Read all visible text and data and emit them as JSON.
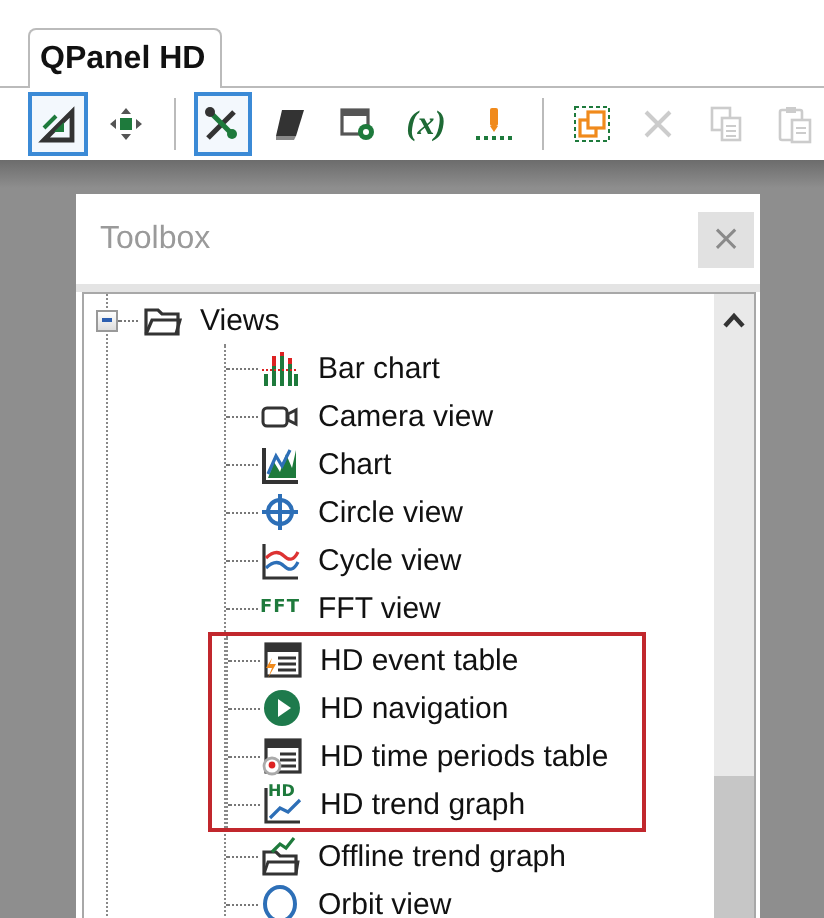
{
  "tabs": [
    {
      "label": "QPanel HD",
      "selected": true
    }
  ],
  "toolbar": [
    {
      "kind": "button",
      "pressed": true,
      "disabled": false
    },
    {
      "kind": "button",
      "pressed": false,
      "disabled": false
    },
    {
      "kind": "separator"
    },
    {
      "kind": "button",
      "pressed": true,
      "disabled": false
    },
    {
      "kind": "button",
      "pressed": false,
      "disabled": false
    },
    {
      "kind": "button",
      "pressed": false,
      "disabled": false
    },
    {
      "kind": "text",
      "label": "(x)",
      "pressed": false,
      "disabled": false
    },
    {
      "kind": "button",
      "pressed": false,
      "disabled": false
    },
    {
      "kind": "separator"
    },
    {
      "kind": "button",
      "pressed": false,
      "disabled": false
    },
    {
      "kind": "button",
      "pressed": false,
      "disabled": true
    },
    {
      "kind": "button",
      "pressed": false,
      "disabled": true
    },
    {
      "kind": "button",
      "pressed": false,
      "disabled": true
    }
  ],
  "toolbox": {
    "title": "Toolbox",
    "close": "×",
    "tree": [
      {
        "label": "Views",
        "expanded": true,
        "children": [
          {
            "label": "Bar chart",
            "highlighted": false
          },
          {
            "label": "Camera view",
            "highlighted": false
          },
          {
            "label": "Chart",
            "highlighted": false
          },
          {
            "label": "Circle view",
            "highlighted": false
          },
          {
            "label": "Cycle view",
            "highlighted": false
          },
          {
            "label": "FFT view",
            "icon_text": "FFT",
            "highlighted": false
          },
          {
            "label": "HD event table",
            "highlighted": true
          },
          {
            "label": "HD navigation",
            "highlighted": true
          },
          {
            "label": "HD time periods table",
            "highlighted": true
          },
          {
            "label": "HD trend graph",
            "icon_text": "HD",
            "highlighted": true
          },
          {
            "label": "Offline trend graph",
            "highlighted": false
          },
          {
            "label": "Orbit view",
            "highlighted": false
          }
        ]
      }
    ]
  }
}
